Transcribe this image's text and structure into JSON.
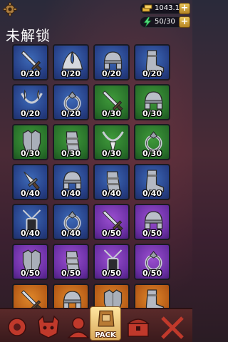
{
  "header": {
    "gold": "1043.1K",
    "energy": "50/30",
    "plus": "+",
    "title": "未解锁"
  },
  "colors": {
    "blue": "#2c4a96",
    "green": "#2e7d2c",
    "purple": "#7a36b4",
    "orange": "#c2621a"
  },
  "items": [
    {
      "icon": "sword-icon",
      "rarity": "blue",
      "count": "0/20"
    },
    {
      "icon": "feather-wings-icon",
      "rarity": "blue",
      "count": "0/20"
    },
    {
      "icon": "helmet-icon",
      "rarity": "blue",
      "count": "0/20"
    },
    {
      "icon": "boots-icon",
      "rarity": "blue",
      "count": "0/20"
    },
    {
      "icon": "feather-necklace-icon",
      "rarity": "blue",
      "count": "0/20"
    },
    {
      "icon": "ring-icon",
      "rarity": "blue",
      "count": "0/20"
    },
    {
      "icon": "sword-icon",
      "rarity": "green",
      "count": "0/30"
    },
    {
      "icon": "helmet-icon",
      "rarity": "green",
      "count": "0/30"
    },
    {
      "icon": "chest-armor-icon",
      "rarity": "green",
      "count": "0/30"
    },
    {
      "icon": "gauntlet-icon",
      "rarity": "green",
      "count": "0/30"
    },
    {
      "icon": "fang-necklace-icon",
      "rarity": "green",
      "count": "0/30"
    },
    {
      "icon": "ring-icon",
      "rarity": "green",
      "count": "0/30"
    },
    {
      "icon": "dagger-icon",
      "rarity": "blue",
      "count": "0/40"
    },
    {
      "icon": "helmet-icon",
      "rarity": "blue",
      "count": "0/40"
    },
    {
      "icon": "gauntlet-icon",
      "rarity": "blue",
      "count": "0/40"
    },
    {
      "icon": "boots-icon",
      "rarity": "blue",
      "count": "0/40"
    },
    {
      "icon": "pendant-icon",
      "rarity": "blue",
      "count": "0/40"
    },
    {
      "icon": "ring-icon",
      "rarity": "blue",
      "count": "0/40"
    },
    {
      "icon": "sword-icon",
      "rarity": "purple",
      "count": "0/50"
    },
    {
      "icon": "helmet-icon",
      "rarity": "purple",
      "count": "0/50"
    },
    {
      "icon": "chest-armor-icon",
      "rarity": "purple",
      "count": "0/50"
    },
    {
      "icon": "gauntlet-icon",
      "rarity": "purple",
      "count": "0/50"
    },
    {
      "icon": "pendant-icon",
      "rarity": "purple",
      "count": "0/50"
    },
    {
      "icon": "ring-icon",
      "rarity": "purple",
      "count": "0/50"
    },
    {
      "icon": "sword-icon",
      "rarity": "orange",
      "count": ""
    },
    {
      "icon": "helmet-icon",
      "rarity": "orange",
      "count": ""
    },
    {
      "icon": "chest-armor-icon",
      "rarity": "orange",
      "count": ""
    },
    {
      "icon": "boots-icon",
      "rarity": "orange",
      "count": ""
    }
  ],
  "nav": [
    {
      "icon": "gear-swirl-icon",
      "label": "",
      "active": false
    },
    {
      "icon": "demon-mask-icon",
      "label": "",
      "active": false
    },
    {
      "icon": "hero-icon",
      "label": "",
      "active": false
    },
    {
      "icon": "pack-icon",
      "label": "PACK",
      "active": true
    },
    {
      "icon": "shop-chest-icon",
      "label": "",
      "active": false
    },
    {
      "icon": "crossed-swords-icon",
      "label": "",
      "active": false
    }
  ]
}
